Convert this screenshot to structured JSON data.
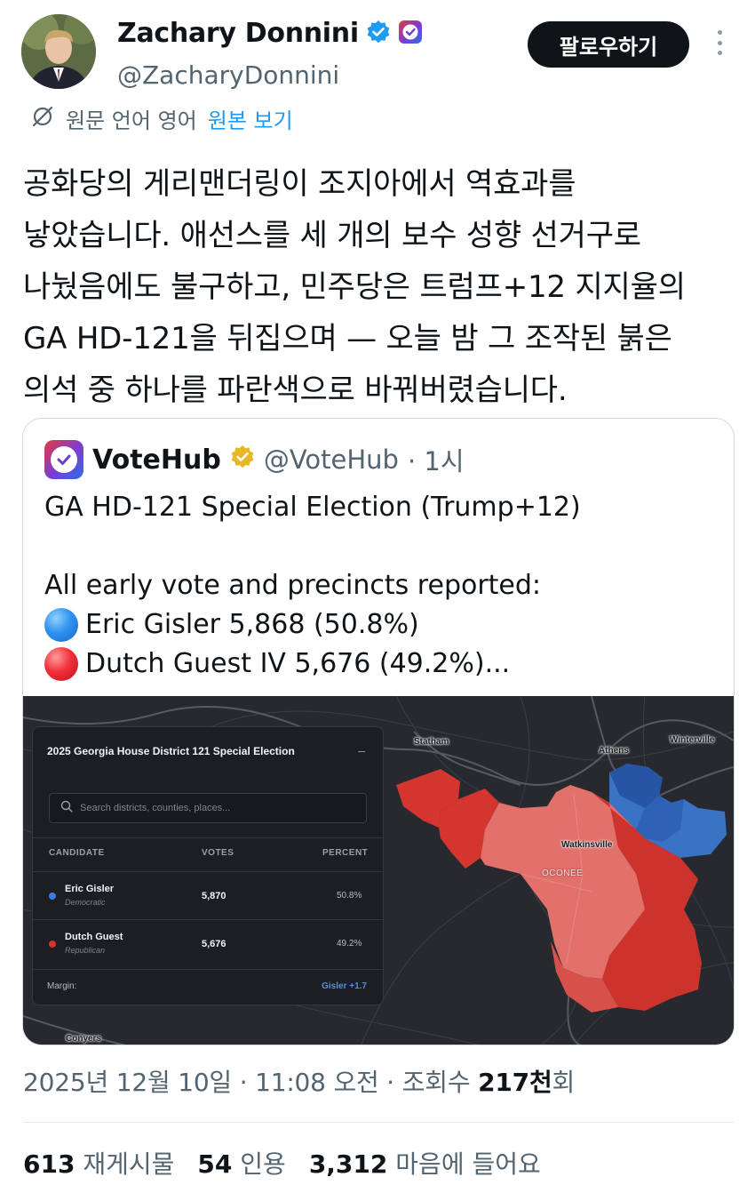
{
  "author": {
    "name": "Zachary Donnini",
    "handle": "@ZacharyDonnini",
    "verified": true,
    "badge_color": "#1d9bf0"
  },
  "follow_label": "팔로우하기",
  "translation": {
    "language_note": "원문 언어 영어",
    "show_original": "원본 보기"
  },
  "tweet_text": "공화당의 게리맨더링이 조지아에서 역효과를\n낳았습니다. 애선스를 세 개의 보수 성향 선거구로\n나눴음에도 불구하고, 민주당은 트럼프+12 지지율의\nGA HD-121을 뒤집으며 — 오늘 밤 그 조작된 붉은\n의석 중 하나를 파란색으로 바꿔버렸습니다.",
  "quote": {
    "name": "VoteHub",
    "handle": "@VoteHub",
    "time": "· 1시",
    "line1": "GA HD-121 Special Election (Trump+12)",
    "line2": "All early vote and precincts reported:",
    "line3": "Eric Gisler 5,868 (50.8%)",
    "line4": "Dutch Guest IV 5,676 (49.2%)..."
  },
  "map_panel": {
    "title": "2025 Georgia House District 121 Special Election",
    "search_placeholder": "Search districts, counties, places...",
    "headers": {
      "candidate": "CANDIDATE",
      "votes": "VOTES",
      "percent": "PERCENT"
    },
    "candidates": [
      {
        "name": "Eric Gisler",
        "party": "Democratic",
        "votes": "5,870",
        "percent": "50.8%",
        "color": "#3b7ddd"
      },
      {
        "name": "Dutch Guest",
        "party": "Republican",
        "votes": "5,676",
        "percent": "49.2%",
        "color": "#d0342c"
      }
    ],
    "margin_label": "Margin:",
    "margin_value": "Gisler +1.7"
  },
  "map_places": {
    "statham": "Statham",
    "athens": "Athens",
    "winterville": "Winterville",
    "watkinsville": "Watkinsville",
    "oconee": "OCONEE",
    "conyers": "Conyers"
  },
  "meta": {
    "date": "2025년 12월 10일 · 11:08 오전 · 조회수 ",
    "views": "217천",
    "views_suffix": "회"
  },
  "stats": {
    "retweets": "613",
    "retweets_label": "재게시물",
    "quotes": "54",
    "quotes_label": "인용",
    "likes": "3,312",
    "likes_label": "마음에 들어요"
  }
}
